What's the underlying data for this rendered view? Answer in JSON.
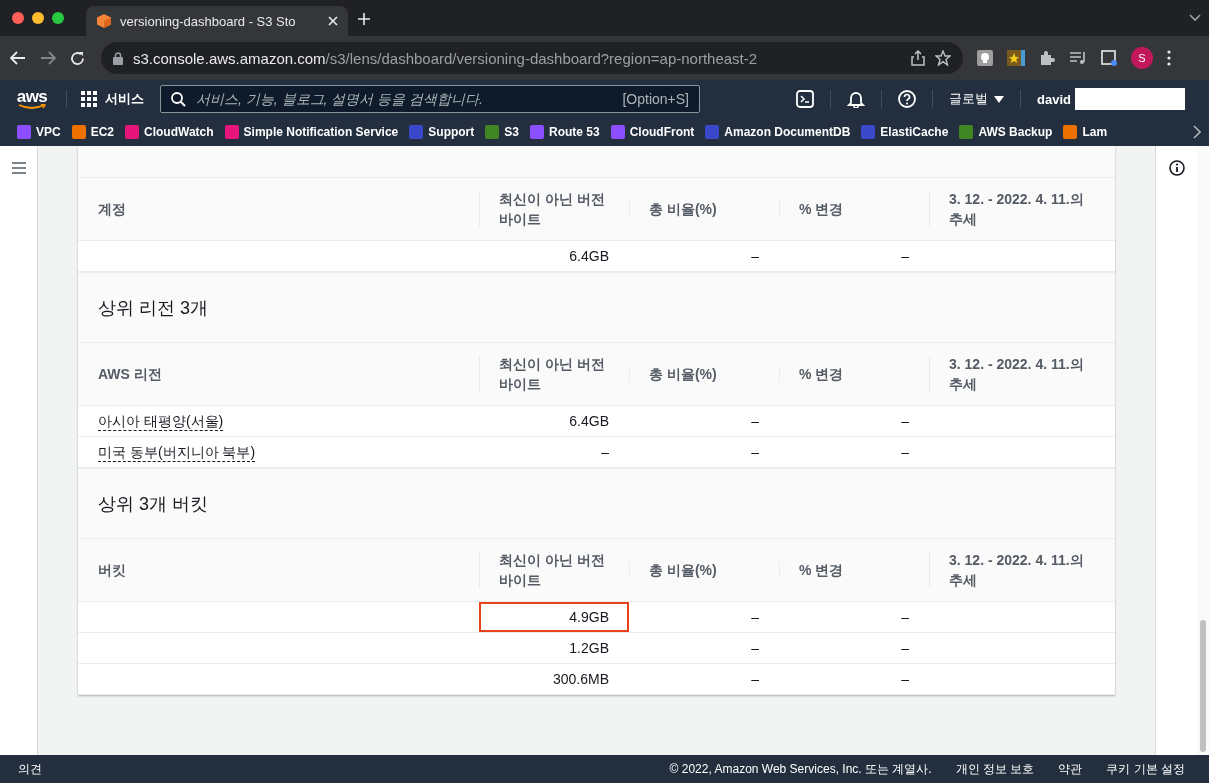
{
  "browser": {
    "tab_title": "versioning-dashboard - S3 Sto",
    "url_host": "s3.console.aws.amazon.com",
    "url_path": "/s3/lens/dashboard/versioning-dashboard?region=ap-northeast-2",
    "profile_initial": "S"
  },
  "console_nav": {
    "logo": "aws",
    "services": "서비스",
    "search_placeholder": "서비스, 기능, 블로그, 설명서 등을 검색합니다.",
    "search_shortcut": "[Option+S]",
    "region": "글로벌",
    "user": "david"
  },
  "bookmarks": [
    {
      "label": "VPC",
      "color": "#8c4fff"
    },
    {
      "label": "EC2",
      "color": "#ed7100"
    },
    {
      "label": "CloudWatch",
      "color": "#e7157b"
    },
    {
      "label": "Simple Notification Service",
      "color": "#e7157b"
    },
    {
      "label": "Support",
      "color": "#3b48cc"
    },
    {
      "label": "S3",
      "color": "#3f8624"
    },
    {
      "label": "Route 53",
      "color": "#8c4fff"
    },
    {
      "label": "CloudFront",
      "color": "#8c4fff"
    },
    {
      "label": "Amazon DocumentDB",
      "color": "#3b48cc"
    },
    {
      "label": "ElastiCache",
      "color": "#3b48cc"
    },
    {
      "label": "AWS Backup",
      "color": "#3f8624"
    },
    {
      "label": "Lam",
      "color": "#ed7100"
    }
  ],
  "sections": [
    {
      "columns": [
        "계정",
        "최신이 아닌 버전 바이트",
        "총 비율(%)",
        "% 변경",
        "3. 12. - 2022. 4. 11.의 추세"
      ],
      "rows": [
        {
          "bytes": "6.4GB",
          "ratio": "–",
          "change": "–",
          "highlighted": false
        }
      ]
    },
    {
      "title": "상위 리전 3개",
      "columns": [
        "AWS 리전",
        "최신이 아닌 버전 바이트",
        "총 비율(%)",
        "% 변경",
        "3. 12. - 2022. 4. 11.의 추세"
      ],
      "rows": [
        {
          "name": "아시아 태평양(서울)",
          "bytes": "6.4GB",
          "ratio": "–",
          "change": "–",
          "highlighted": false
        },
        {
          "name": "미국 동부(버지니아 북부)",
          "bytes": "–",
          "ratio": "–",
          "change": "–",
          "highlighted": false
        }
      ]
    },
    {
      "title": "상위 3개 버킷",
      "columns": [
        "버킷",
        "최신이 아닌 버전 바이트",
        "총 비율(%)",
        "% 변경",
        "3. 12. - 2022. 4. 11.의 추세"
      ],
      "rows": [
        {
          "bytes": "4.9GB",
          "ratio": "–",
          "change": "–",
          "highlighted": true
        },
        {
          "bytes": "1.2GB",
          "ratio": "–",
          "change": "–",
          "highlighted": false
        },
        {
          "bytes": "300.6MB",
          "ratio": "–",
          "change": "–",
          "highlighted": false
        }
      ]
    }
  ],
  "footer": {
    "feedback": "의견",
    "copyright": "© 2022, Amazon Web Services, Inc. 또는 계열사.",
    "links": [
      "개인 정보 보호",
      "약관",
      "쿠키 기본 설정"
    ]
  }
}
